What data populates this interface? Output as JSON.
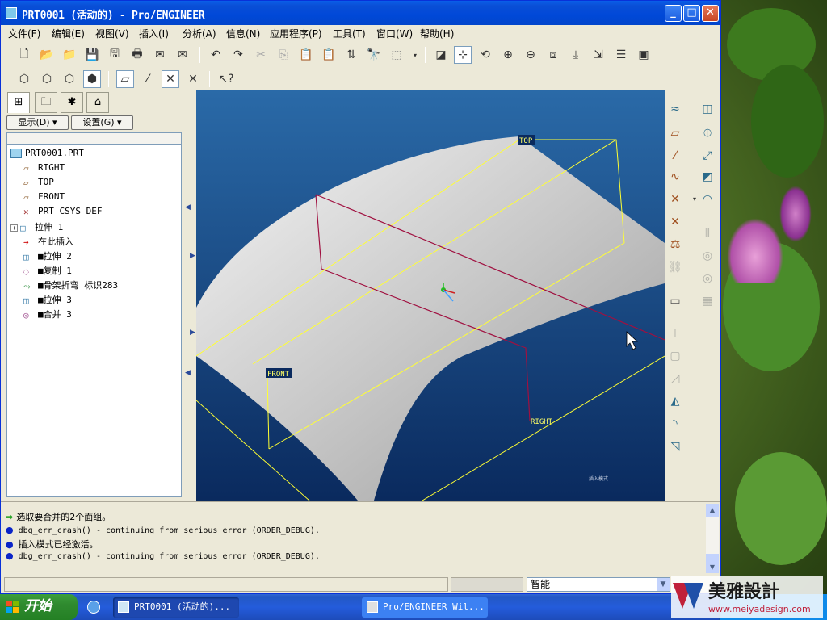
{
  "window": {
    "title": "PRT0001 (活动的) - Pro/ENGINEER"
  },
  "menu": [
    "文件(F)",
    "编辑(E)",
    "视图(V)",
    "插入(I)",
    "分析(A)",
    "信息(N)",
    "应用程序(P)",
    "工具(T)",
    "窗口(W)",
    "帮助(H)"
  ],
  "panel": {
    "show_label": "显示(D) ▾",
    "settings_label": "设置(G) ▾"
  },
  "tree": [
    {
      "label": "PRT0001.PRT",
      "icon": "part-icon"
    },
    {
      "label": "RIGHT",
      "icon": "datum-plane-icon"
    },
    {
      "label": "TOP",
      "icon": "datum-plane-icon"
    },
    {
      "label": "FRONT",
      "icon": "datum-plane-icon"
    },
    {
      "label": "PRT_CSYS_DEF",
      "icon": "coordinate-system-icon"
    },
    {
      "label": "拉伸 1",
      "icon": "extrude-icon"
    },
    {
      "label": "在此插入",
      "icon": "insert-here-arrow-icon"
    },
    {
      "label": "■拉伸 2",
      "icon": "extrude-icon"
    },
    {
      "label": "■复制 1",
      "icon": "copy-icon"
    },
    {
      "label": "■骨架折弯 标识283",
      "icon": "spinal-bend-icon"
    },
    {
      "label": "■拉伸 3",
      "icon": "extrude-icon"
    },
    {
      "label": "■合并 3",
      "icon": "merge-icon"
    }
  ],
  "viewport": {
    "labels": {
      "top": "TOP",
      "front": "FRONT",
      "right": "RIGHT"
    },
    "mode_text": "插入模式",
    "colors": {
      "background_top": "#2a6aa8",
      "background_bottom": "#0a2a5e",
      "datum": "#ffff33",
      "selected": "#a01040"
    }
  },
  "messages": [
    {
      "icon": "green-arrow-icon",
      "text": "选取要合并的2个面组。"
    },
    {
      "icon": "info-bullet-icon",
      "text": "dbg_err_crash() - continuing from serious error (ORDER_DEBUG)."
    },
    {
      "icon": "info-bullet-icon",
      "text": "插入模式已经激活。"
    },
    {
      "icon": "info-bullet-icon",
      "text": "dbg_err_crash() - continuing from serious error (ORDER_DEBUG)."
    }
  ],
  "status": {
    "filter_value": "智能"
  },
  "taskbar": {
    "start_label": "开始",
    "buttons": [
      "PRT0001 (活动的)...",
      "Pro/ENGINEER Wil..."
    ]
  },
  "watermark": {
    "title": "美雅設計",
    "url": "www.meiyadesign.com"
  }
}
